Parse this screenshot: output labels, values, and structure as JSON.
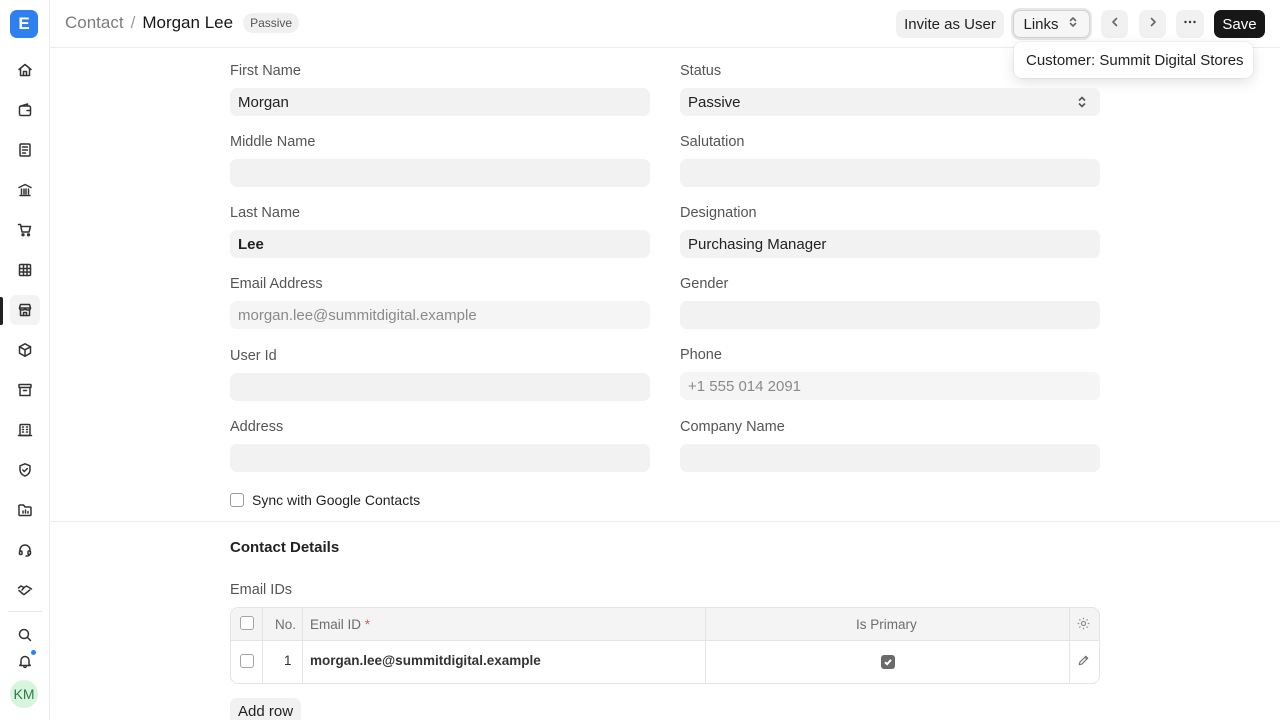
{
  "sidebar": {
    "logo_letter": "E",
    "avatar_initials": "KM",
    "icons": [
      "home-icon",
      "wallet-icon",
      "invoice-icon",
      "bank-icon",
      "cart-icon",
      "table-icon",
      "store-icon",
      "package-icon",
      "archive-icon",
      "building-icon",
      "shield-icon",
      "folder-icon",
      "headset-icon",
      "handshake-icon",
      "search-icon",
      "bell-icon"
    ]
  },
  "header": {
    "breadcrumb_parent": "Contact",
    "breadcrumb_separator": "/",
    "title": "Morgan Lee",
    "status_badge": "Passive",
    "invite_label": "Invite as User",
    "links_label": "Links",
    "save_label": "Save",
    "links_dropdown_item": "Customer: Summit Digital Stores"
  },
  "form": {
    "first_name": {
      "label": "First Name",
      "value": "Morgan"
    },
    "status": {
      "label": "Status",
      "value": "Passive"
    },
    "middle_name": {
      "label": "Middle Name",
      "value": ""
    },
    "salutation": {
      "label": "Salutation",
      "value": ""
    },
    "last_name": {
      "label": "Last Name",
      "value": "Lee"
    },
    "designation": {
      "label": "Designation",
      "value": "Purchasing Manager"
    },
    "email_address": {
      "label": "Email Address",
      "value": "morgan.lee@summitdigital.example"
    },
    "gender": {
      "label": "Gender",
      "value": ""
    },
    "user_id": {
      "label": "User Id",
      "value": ""
    },
    "phone": {
      "label": "Phone",
      "value": "+1 555 014 2091"
    },
    "address": {
      "label": "Address",
      "value": ""
    },
    "company_name": {
      "label": "Company Name",
      "value": ""
    },
    "sync_google": {
      "label": "Sync with Google Contacts",
      "checked": false
    }
  },
  "contact_details": {
    "section_title": "Contact Details",
    "email_ids_label": "Email IDs",
    "columns": {
      "no": "No.",
      "email_id": "Email ID",
      "required_mark": "*",
      "is_primary": "Is Primary"
    },
    "rows": [
      {
        "no": "1",
        "email_id": "morgan.lee@summitdigital.example",
        "is_primary": true
      }
    ],
    "add_row_label": "Add row"
  }
}
